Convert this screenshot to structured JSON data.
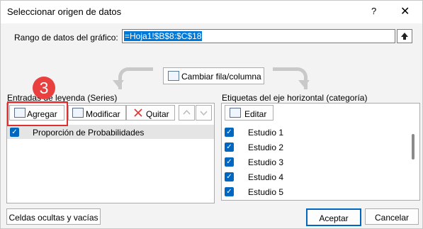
{
  "window": {
    "title": "Seleccionar origen de datos",
    "help_icon": "?",
    "close_icon": "✕"
  },
  "range": {
    "label": "Rango de datos del gráfico:",
    "value": "=Hoja1!$B$8:$C$18",
    "collapse_icon": "up-arrow-icon"
  },
  "switch_button": {
    "label": "Cambiar fila/columna"
  },
  "series_panel": {
    "heading": "Entradas de leyenda (Series)",
    "add_label": "Agregar",
    "edit_label": "Modificar",
    "remove_label": "Quitar",
    "items": [
      {
        "label": "Proporción de Probabilidades",
        "checked": true
      }
    ]
  },
  "category_panel": {
    "heading": "Etiquetas del eje horizontal (categoría)",
    "edit_label": "Editar",
    "items": [
      {
        "label": "Estudio 1",
        "checked": true
      },
      {
        "label": "Estudio 2",
        "checked": true
      },
      {
        "label": "Estudio 3",
        "checked": true
      },
      {
        "label": "Estudio 4",
        "checked": true
      },
      {
        "label": "Estudio 5",
        "checked": true
      }
    ]
  },
  "footer": {
    "hidden_cells": "Celdas ocultas y vacías",
    "ok": "Aceptar",
    "cancel": "Cancelar"
  },
  "annotation": {
    "badge_number": "3",
    "highlight_color": "#e02d2d",
    "badge_color": "#e93f3f"
  },
  "colors": {
    "accent": "#0067c0",
    "selected_text_bg": "#0078d7"
  }
}
